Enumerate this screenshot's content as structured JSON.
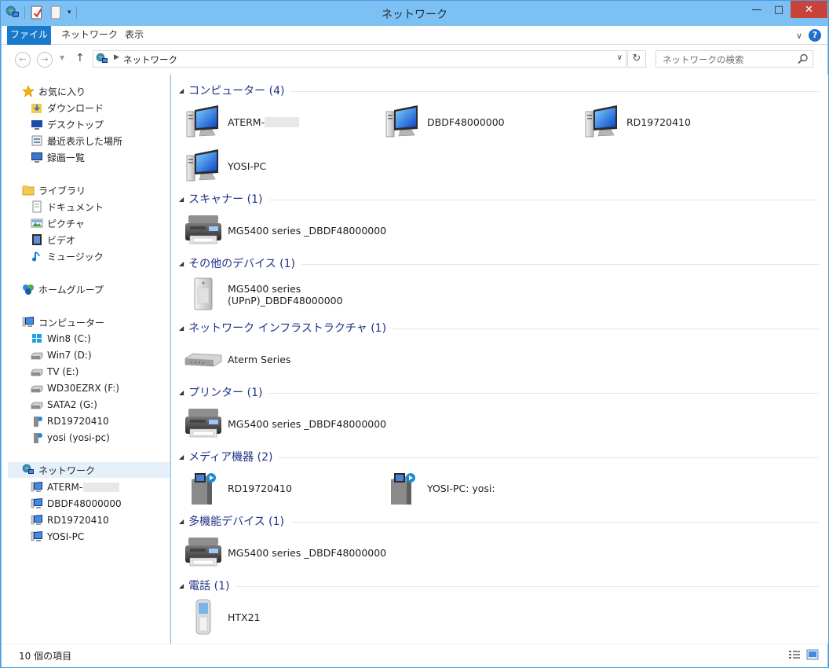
{
  "window": {
    "title": "ネットワーク"
  },
  "controls": {
    "minimize": "—",
    "maximize": "□",
    "close": "✕"
  },
  "ribbon": {
    "tabs": [
      "ファイル",
      "ネットワーク",
      "表示"
    ],
    "expand": "∨",
    "help": "?"
  },
  "address": {
    "back": "←",
    "forward": "→",
    "recent": "▼",
    "up": "↑",
    "path": "ネットワーク",
    "dropdown": "∨",
    "refresh": "↻",
    "search_placeholder": "ネットワークの検索"
  },
  "nav": {
    "favorites": {
      "label": "お気に入り",
      "items": [
        "ダウンロード",
        "デスクトップ",
        "最近表示した場所",
        "録画一覧"
      ]
    },
    "libraries": {
      "label": "ライブラリ",
      "items": [
        "ドキュメント",
        "ピクチャ",
        "ビデオ",
        "ミュージック"
      ]
    },
    "homegroup": {
      "label": "ホームグループ"
    },
    "computer": {
      "label": "コンピューター",
      "items": [
        "Win8 (C:)",
        "Win7 (D:)",
        "TV (E:)",
        "WD30EZRX (F:)",
        "SATA2 (G:)",
        "RD19720410",
        "yosi (yosi-pc)"
      ]
    },
    "network": {
      "label": "ネットワーク",
      "items": [
        "ATERM-",
        "DBDF48000000",
        "RD19720410",
        "YOSI-PC"
      ]
    }
  },
  "groups": [
    {
      "title": "コンピューター (4)",
      "items": [
        "ATERM-",
        "DBDF48000000",
        "RD19720410",
        "YOSI-PC"
      ]
    },
    {
      "title": "スキャナー (1)",
      "items": [
        "MG5400 series _DBDF48000000"
      ]
    },
    {
      "title": "その他のデバイス (1)",
      "items": [
        "MG5400 series (UPnP)_DBDF48000000"
      ]
    },
    {
      "title": "ネットワーク インフラストラクチャ (1)",
      "items": [
        "Aterm Series"
      ]
    },
    {
      "title": "プリンター (1)",
      "items": [
        "MG5400 series _DBDF48000000"
      ]
    },
    {
      "title": "メディア機器 (2)",
      "items": [
        "RD19720410",
        "YOSI-PC: yosi:"
      ]
    },
    {
      "title": "多機能デバイス (1)",
      "items": [
        "MG5400 series _DBDF48000000"
      ]
    },
    {
      "title": "電話 (1)",
      "items": [
        "HTX21"
      ]
    }
  ],
  "group_collapse_glyph": "◢",
  "status": {
    "count": "10 個の項目"
  },
  "colors": {
    "accent": "#1979ca",
    "title_bar": "#7cc0f4",
    "group_header": "#1e3287",
    "close": "#c7443a"
  }
}
